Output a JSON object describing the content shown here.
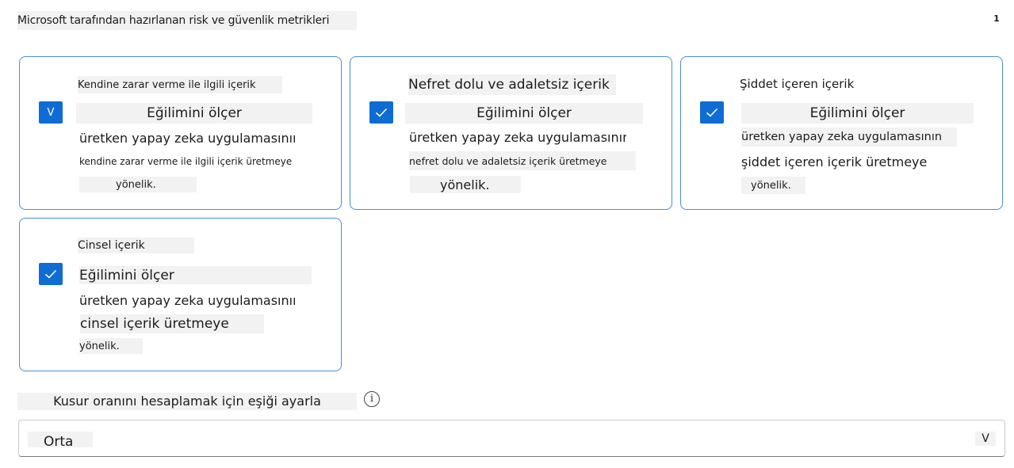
{
  "header": {
    "title": "Microsoft tarafından hazırlanan risk ve güvenlik metrikleri",
    "page_number": "1"
  },
  "cards": [
    {
      "checked": true,
      "check_glyph": "V",
      "name": "Kendine zarar verme ile ilgili içerik",
      "measure": "Eğilimini ölçer",
      "line1": "üretken yapay zeka uygulamasının",
      "line2": "kendine zarar verme ile ilgili içerik üretmeye",
      "line3": "yönelik."
    },
    {
      "checked": true,
      "name": "Nefret dolu ve adaletsiz içerik",
      "measure": "Eğilimini ölçer",
      "line1": "üretken yapay zeka uygulamasının",
      "line2": "nefret dolu ve adaletsiz içerik üretmeye",
      "line3": "yönelik."
    },
    {
      "checked": true,
      "name": "Şiddet içeren içerik",
      "measure": "Eğilimini ölçer",
      "line1": "üretken yapay zeka uygulamasının",
      "line2": "şiddet içeren içerik üretmeye",
      "line3": "yönelik."
    },
    {
      "checked": true,
      "name": "Cinsel içerik",
      "measure": "Eğilimini ölçer",
      "line1": "üretken yapay zeka uygulamasının",
      "line2": "cinsel içerik üretmeye",
      "line3": "yönelik."
    }
  ],
  "threshold": {
    "label": "Kusur oranını hesaplamak için eşiği ayarla",
    "info_icon": "i",
    "selected": "Orta",
    "chevron": "V"
  },
  "colors": {
    "accent": "#0f6cd4",
    "card_border": "#4a8fd6",
    "highlight": "#f2f2f2"
  }
}
